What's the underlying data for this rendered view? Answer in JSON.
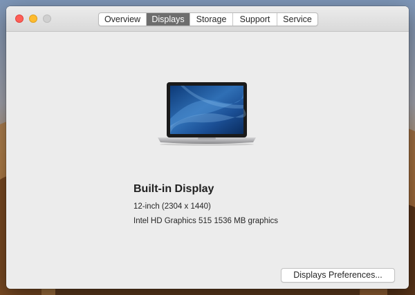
{
  "window": {
    "tabs": [
      {
        "label": "Overview"
      },
      {
        "label": "Displays"
      },
      {
        "label": "Storage"
      },
      {
        "label": "Support"
      },
      {
        "label": "Service"
      }
    ],
    "active_tab": "Displays"
  },
  "display": {
    "name": "Built-in Display",
    "size_resolution": "12-inch (2304 x 1440)",
    "graphics": "Intel HD Graphics 515 1536 MB graphics",
    "icon": "laptop-icon"
  },
  "actions": {
    "preferences_label": "Displays Preferences..."
  },
  "colors": {
    "close": "#fe5f57",
    "minimize": "#febb2e",
    "zoom_disabled": "#d0d0d0",
    "active_tab_bg": "#6d6d6d",
    "window_bg": "#ececec"
  }
}
